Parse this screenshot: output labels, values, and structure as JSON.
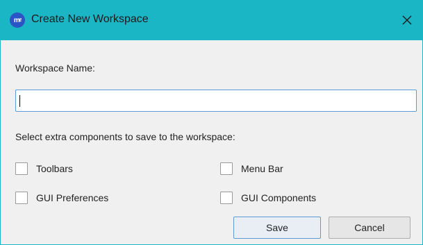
{
  "window": {
    "title": "Create New Workspace",
    "app_icon_text": "m͡ℓ",
    "close_glyph": "✕"
  },
  "form": {
    "workspace_name_label": "Workspace Name:",
    "workspace_name_value": "",
    "components_prompt": "Select extra components to save to the workspace:",
    "options": [
      {
        "label": "Toolbars",
        "checked": false
      },
      {
        "label": "Menu Bar",
        "checked": false
      },
      {
        "label": "GUI Preferences",
        "checked": false
      },
      {
        "label": "GUI Components",
        "checked": false
      }
    ]
  },
  "buttons": {
    "save": "Save",
    "cancel": "Cancel"
  },
  "colors": {
    "titlebar": "#1ab6c6",
    "focus_border": "#5b9bd5"
  }
}
